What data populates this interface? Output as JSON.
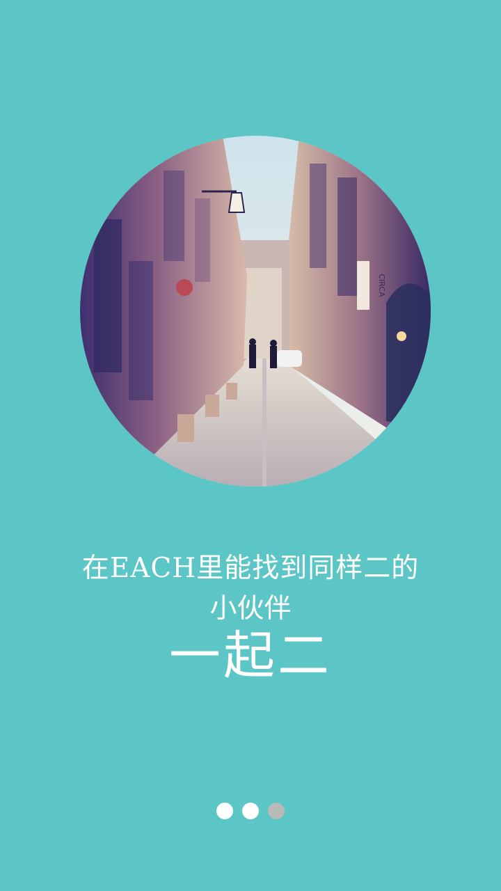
{
  "onboarding": {
    "line1": "在EACH里能找到同样二的",
    "line2": "小伙伴",
    "line3": "一起二",
    "photo_sign_text": "CIRCA"
  },
  "pager": {
    "total": 3,
    "current_index": 2,
    "dots": [
      {
        "state": "inactive"
      },
      {
        "state": "inactive"
      },
      {
        "state": "active"
      }
    ]
  },
  "colors": {
    "background": "#5cc5c6",
    "text": "#ffffff",
    "dot_inactive": "#ffffff",
    "dot_active": "#b9b9b9"
  }
}
